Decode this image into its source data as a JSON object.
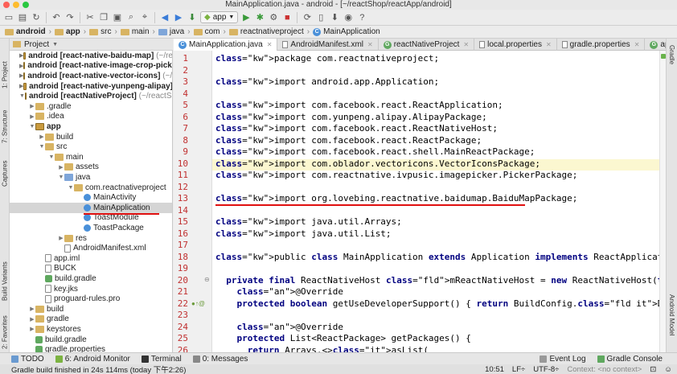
{
  "window_title": "MainApplication.java - android - [~/reactShop/reactApp/android]",
  "toolbar": {
    "run_config": "app"
  },
  "breadcrumb": [
    "android",
    "app",
    "src",
    "main",
    "java",
    "com",
    "reactnativeproject",
    "MainApplication"
  ],
  "left_tool_tabs": [
    "1: Project",
    "7: Structure",
    "Captures",
    "Build Variants",
    "2: Favorites"
  ],
  "right_tool_tabs": [
    "Gradle",
    "Android Model"
  ],
  "project_panel": {
    "header": "Project",
    "rows": [
      {
        "label": "android [react-native-baidu-map]",
        "path": "(~/re",
        "bold": true
      },
      {
        "label": "android [react-native-image-crop-picke",
        "path": "",
        "bold": true
      },
      {
        "label": "android [react-native-vector-icons]",
        "path": "(~/re",
        "bold": true
      },
      {
        "label": "android [react-native-yunpeng-alipay]",
        "path": "",
        "bold": true
      },
      {
        "label": "android [reactNativeProject]",
        "path": "(~/reactShop",
        "bold": true
      },
      {
        "label": ".gradle"
      },
      {
        "label": ".idea"
      },
      {
        "label": "app",
        "bold": true
      },
      {
        "label": "build"
      },
      {
        "label": "src"
      },
      {
        "label": "main"
      },
      {
        "label": "assets"
      },
      {
        "label": "java"
      },
      {
        "label": "com.reactnativeproject"
      },
      {
        "label": "MainActivity"
      },
      {
        "label": "MainApplication"
      },
      {
        "label": "ToastModule"
      },
      {
        "label": "ToastPackage"
      },
      {
        "label": "res"
      },
      {
        "label": "AndroidManifest.xml"
      },
      {
        "label": "app.iml"
      },
      {
        "label": "BUCK"
      },
      {
        "label": "build.gradle"
      },
      {
        "label": "key.jks"
      },
      {
        "label": "proguard-rules.pro"
      },
      {
        "label": "build"
      },
      {
        "label": "gradle"
      },
      {
        "label": "keystores"
      },
      {
        "label": "build.gradle"
      },
      {
        "label": "gradle.properties"
      }
    ]
  },
  "editor_tabs": [
    "MainApplication.java",
    "AndroidManifest.xml",
    "reactNativeProject",
    "local.properties",
    "gradle.properties",
    "app"
  ],
  "editor": {
    "line_numbers": [
      "1",
      "2",
      "3",
      "4",
      "5",
      "6",
      "7",
      "8",
      "9",
      "10",
      "11",
      "12",
      "13",
      "14",
      "15",
      "16",
      "17",
      "18",
      "19",
      "20",
      "21",
      "22",
      "23",
      "24",
      "25",
      "26",
      "27",
      "28"
    ],
    "lines": [
      "package com.reactnativeproject;",
      "",
      "import android.app.Application;",
      "",
      "import com.facebook.react.ReactApplication;",
      "import com.yunpeng.alipay.AlipayPackage;",
      "import com.facebook.react.ReactNativeHost;",
      "import com.facebook.react.ReactPackage;",
      "import com.facebook.react.shell.MainReactPackage;",
      "import com.oblador.vectoricons.VectorIconsPackage;",
      "import com.reactnative.ivpusic.imagepicker.PickerPackage;",
      "",
      "import org.lovebing.reactnative.baidumap.BaiduMapPackage;",
      "",
      "import java.util.Arrays;",
      "import java.util.List;",
      "",
      "public class MainApplication extends Application implements ReactApplication {",
      "",
      "  private final ReactNativeHost mReactNativeHost = new ReactNativeHost(this) {",
      "    @Override",
      "    protected boolean getUseDeveloperSupport() { return BuildConfig.DEBUG; }",
      "",
      "    @Override",
      "    protected List<ReactPackage> getPackages() {",
      "      return Arrays.<>asList("
    ]
  },
  "bottom_tools": [
    "TODO",
    "6: Android Monitor",
    "Terminal",
    "0: Messages"
  ],
  "bottom_right_tools": [
    "Event Log",
    "Gradle Console"
  ],
  "status": {
    "message": "Gradle build finished in 24s 114ms (today 下午2:26)",
    "position": "10:51",
    "line_sep": "LF÷",
    "encoding": "UTF-8÷",
    "context": "Context: <no context>"
  }
}
